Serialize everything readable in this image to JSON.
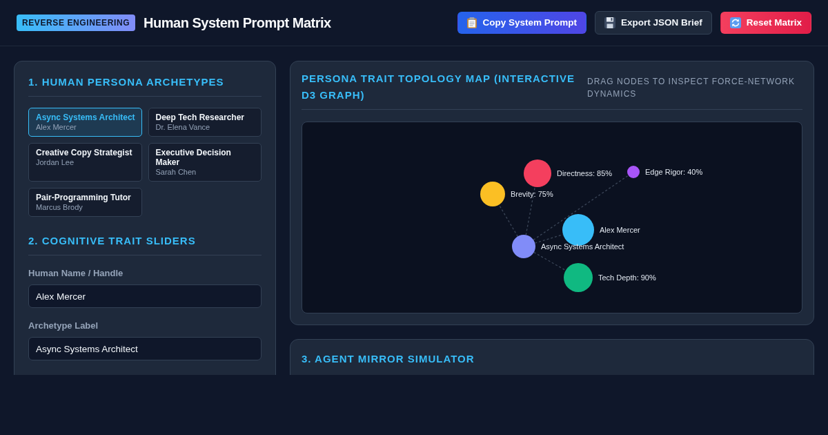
{
  "header": {
    "tag": "REVERSE ENGINEERING",
    "title": "Human System Prompt Matrix",
    "buttons": [
      {
        "label": "Copy System Prompt",
        "kind": "copy"
      },
      {
        "label": "Export JSON Brief",
        "kind": "export"
      },
      {
        "label": "Reset Matrix",
        "kind": "reset"
      }
    ]
  },
  "archetypes_panel": {
    "title": "1. HUMAN PERSONA ARCHETYPES",
    "cards": [
      {
        "title": "Async Systems Architect",
        "name": "Alex Mercer",
        "selected": true
      },
      {
        "title": "Deep Tech Researcher",
        "name": "Dr. Elena Vance",
        "selected": false
      },
      {
        "title": "Creative Copy Strategist",
        "name": "Jordan Lee",
        "selected": false
      },
      {
        "title": "Executive Decision Maker",
        "name": "Sarah Chen",
        "selected": false
      },
      {
        "title": "Pair-Programming Tutor",
        "name": "Marcus Brody",
        "selected": false
      }
    ]
  },
  "traits_panel": {
    "title": "2. COGNITIVE TRAIT SLIDERS",
    "fields": [
      {
        "label": "Human Name / Handle",
        "value": "Alex Mercer"
      },
      {
        "label": "Archetype Label",
        "value": "Async Systems Architect"
      }
    ]
  },
  "topology_panel": {
    "title": "PERSONA TRAIT TOPOLOGY MAP (INTERACTIVE D3 GRAPH)",
    "hint": "DRAG NODES TO INSPECT FORCE-NETWORK DYNAMICS",
    "nodes": [
      {
        "label": "Alex Mercer",
        "kind": "human",
        "color": "#38bdf8"
      },
      {
        "label": "Async Systems Architect",
        "kind": "archetype",
        "color": "#818cf8"
      },
      {
        "label": "Tech Depth: 90%",
        "kind": "trait",
        "color": "#10b981"
      },
      {
        "label": "Brevity: 75%",
        "kind": "trait",
        "color": "#fbbf24"
      },
      {
        "label": "Directness: 85%",
        "kind": "trait",
        "color": "#f43f5e"
      },
      {
        "label": "Edge Rigor: 40%",
        "kind": "trait",
        "color": "#a855f7"
      }
    ]
  },
  "simulator_panel": {
    "title": "3. AGENT MIRROR SIMULATOR"
  }
}
